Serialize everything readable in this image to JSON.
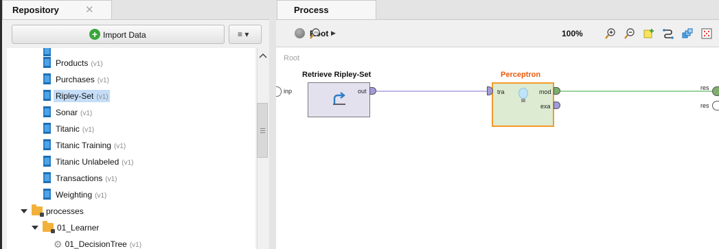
{
  "repository": {
    "tab_title": "Repository",
    "import_label": "Import Data",
    "menu_label": "≡ ▾",
    "items": [
      {
        "label": "Products",
        "version": "(v1)"
      },
      {
        "label": "Purchases",
        "version": "(v1)"
      },
      {
        "label": "Ripley-Set",
        "version": "(v1)",
        "selected": true
      },
      {
        "label": "Sonar",
        "version": "(v1)"
      },
      {
        "label": "Titanic",
        "version": "(v1)"
      },
      {
        "label": "Titanic Training",
        "version": "(v1)"
      },
      {
        "label": "Titanic Unlabeled",
        "version": "(v1)"
      },
      {
        "label": "Transactions",
        "version": "(v1)"
      },
      {
        "label": "Weighting",
        "version": "(v1)"
      }
    ],
    "folders": {
      "processes": "processes",
      "learner": "01_Learner",
      "decision_tree": "01_DecisionTree",
      "decision_tree_version": "(v1)"
    }
  },
  "process": {
    "tab_title": "Process",
    "breadcrumb": "Root",
    "zoom": "100%",
    "canvas_label": "Root",
    "input_port": "inp",
    "operators": {
      "retrieve": {
        "name": "Retrieve Ripley-Set",
        "out_port": "out"
      },
      "perceptron": {
        "name": "Perceptron",
        "in_port": "tra",
        "mod_port": "mod",
        "exa_port": "exa"
      }
    },
    "result_ports": [
      "res",
      "res"
    ]
  },
  "colors": {
    "selection": "#c5ddf7",
    "perceptron_border": "#f39a2b",
    "perceptron_title": "#e8590c",
    "perceptron_fill": "#dcebd1",
    "retrieve_fill": "#e4e1ef",
    "connection_purple": "#9a8dd6",
    "connection_green": "#5cb85c"
  }
}
